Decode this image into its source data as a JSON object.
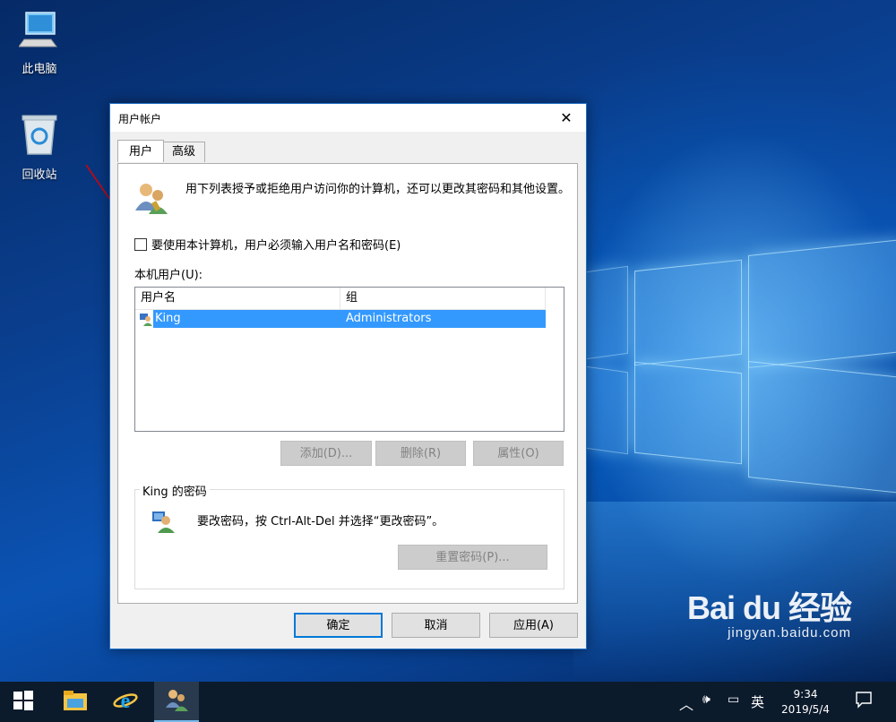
{
  "desktop": {
    "icons": [
      {
        "label": "此电脑",
        "icon": "computer-icon"
      },
      {
        "label": "回收站",
        "icon": "recycle-bin-icon"
      }
    ]
  },
  "dialog": {
    "title": "用户帐户",
    "close_glyph": "✕",
    "tabs": [
      {
        "label": "用户",
        "active": true
      },
      {
        "label": "高级",
        "active": false
      }
    ],
    "intro_text": "用下列表授予或拒绝用户访问你的计算机，还可以更改其密码和其他设置。",
    "require_login_checkbox": {
      "label": "要使用本计算机，用户必须输入用户名和密码(E)",
      "checked": false
    },
    "users_label": "本机用户(U):",
    "user_table": {
      "columns": [
        "用户名",
        "组"
      ],
      "rows": [
        {
          "username": "King",
          "group": "Administrators",
          "selected": true
        }
      ]
    },
    "buttons": {
      "add": "添加(D)...",
      "remove": "删除(R)",
      "properties": "属性(O)"
    },
    "password_group": {
      "title": "King 的密码",
      "text": "要改密码，按 Ctrl-Alt-Del 并选择“更改密码”。",
      "reset_button": "重置密码(P)..."
    },
    "footer": {
      "ok": "确定",
      "cancel": "取消",
      "apply": "应用(A)"
    }
  },
  "taskbar": {
    "items": [
      "start-icon",
      "file-explorer-icon",
      "internet-explorer-icon",
      "user-accounts-icon"
    ],
    "tray": {
      "language": "英",
      "time": "9:34",
      "date": "2019/5/4"
    }
  },
  "watermark": {
    "brand": "Bai du 经验",
    "url": "jingyan.baidu.com"
  },
  "colors": {
    "selection": "#3399ff",
    "accent": "#0078d7",
    "taskbar": "#0c1b2c",
    "annotation_arrow": "#e00000"
  }
}
